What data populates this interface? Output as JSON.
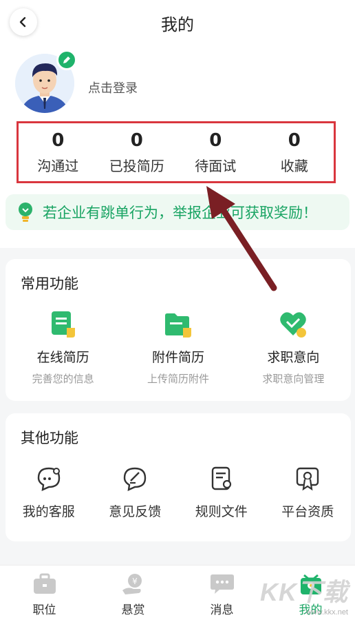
{
  "header": {
    "title": "我的"
  },
  "profile": {
    "login_text": "点击登录"
  },
  "stats": [
    {
      "value": "0",
      "label": "沟通过"
    },
    {
      "value": "0",
      "label": "已投简历"
    },
    {
      "value": "0",
      "label": "待面试"
    },
    {
      "value": "0",
      "label": "收藏"
    }
  ],
  "notice": {
    "text": "若企业有跳单行为，举报企业可获取奖励！"
  },
  "common": {
    "title": "常用功能",
    "items": [
      {
        "name": "在线简历",
        "sub": "完善您的信息",
        "icon": "online-resume-icon"
      },
      {
        "name": "附件简历",
        "sub": "上传简历附件",
        "icon": "folder-resume-icon"
      },
      {
        "name": "求职意向",
        "sub": "求职意向管理",
        "icon": "heart-intent-icon"
      }
    ]
  },
  "other": {
    "title": "其他功能",
    "items": [
      {
        "name": "我的客服",
        "icon": "chat-service-icon"
      },
      {
        "name": "意见反馈",
        "icon": "feedback-icon"
      },
      {
        "name": "规则文件",
        "icon": "rules-document-icon"
      },
      {
        "name": "平台资质",
        "icon": "certificate-icon"
      }
    ]
  },
  "tabbar": {
    "items": [
      {
        "label": "职位",
        "icon": "briefcase-icon"
      },
      {
        "label": "悬赏",
        "icon": "reward-money-icon"
      },
      {
        "label": "消息",
        "icon": "message-icon"
      },
      {
        "label": "我的",
        "icon": "profile-tab-icon",
        "active": true
      }
    ]
  },
  "watermark": {
    "main": "KK下载",
    "sub": "www.kkx.net"
  },
  "colors": {
    "accent_green": "#19a463",
    "highlight_red": "#d9363e",
    "arrow": "#7a1f24"
  }
}
